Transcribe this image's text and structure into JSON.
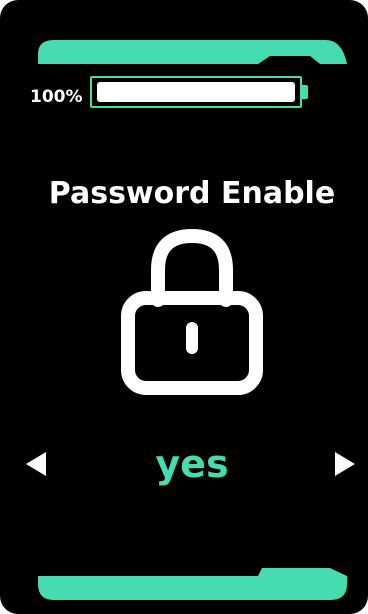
{
  "battery": {
    "label": "100%",
    "level_percent": 100
  },
  "setting": {
    "title": "Password Enable",
    "value": "yes",
    "icon": "lock-icon"
  },
  "navigation": {
    "prev_icon": "arrow-left-icon",
    "next_icon": "arrow-right-icon"
  },
  "colors": {
    "accent": "#46dcaf",
    "background": "#000000",
    "text": "#ffffff"
  }
}
